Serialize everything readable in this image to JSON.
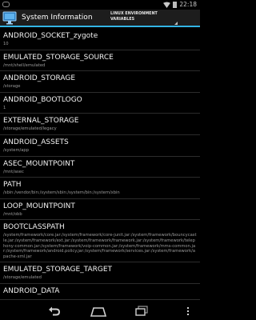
{
  "status_bar": {
    "time": "22:18",
    "icons": [
      "notification-icon",
      "wifi-icon",
      "battery-icon"
    ]
  },
  "action_bar": {
    "title": "System Information",
    "tab_line1": "LINUX ENVIRONMENT",
    "tab_line2": "VARIABLES",
    "accent_color": "#33b5e5"
  },
  "variables": [
    {
      "name": "ANDROID_SOCKET_zygote",
      "value": "10"
    },
    {
      "name": "EMULATED_STORAGE_SOURCE",
      "value": "/mnt/shell/emulated"
    },
    {
      "name": "ANDROID_STORAGE",
      "value": "/storage"
    },
    {
      "name": "ANDROID_BOOTLOGO",
      "value": "1"
    },
    {
      "name": "EXTERNAL_STORAGE",
      "value": "/storage/emulated/legacy"
    },
    {
      "name": "ANDROID_ASSETS",
      "value": "/system/app"
    },
    {
      "name": "ASEC_MOUNTPOINT",
      "value": "/mnt/asec"
    },
    {
      "name": "PATH",
      "value": "/sbin:/vendor/bin:/system/sbin:/system/bin:/system/xbin"
    },
    {
      "name": "LOOP_MOUNTPOINT",
      "value": "/mnt/obb"
    },
    {
      "name": "BOOTCLASSPATH",
      "value": "/system/framework/core.jar:/system/framework/core-junit.jar:/system/framework/bouncycastle.jar:/system/framework/ext.jar:/system/framework/framework.jar:/system/framework/telephony-common.jar:/system/framework/voip-common.jar:/system/framework/mms-common.jar:/system/framework/android.policy.jar:/system/framework/services.jar:/system/framework/apache-xml.jar"
    },
    {
      "name": "EMULATED_STORAGE_TARGET",
      "value": "/storage/emulated"
    },
    {
      "name": "ANDROID_DATA",
      "value": ""
    }
  ],
  "nav_bar": {
    "buttons": [
      "back",
      "home",
      "recent-apps",
      "menu"
    ]
  }
}
